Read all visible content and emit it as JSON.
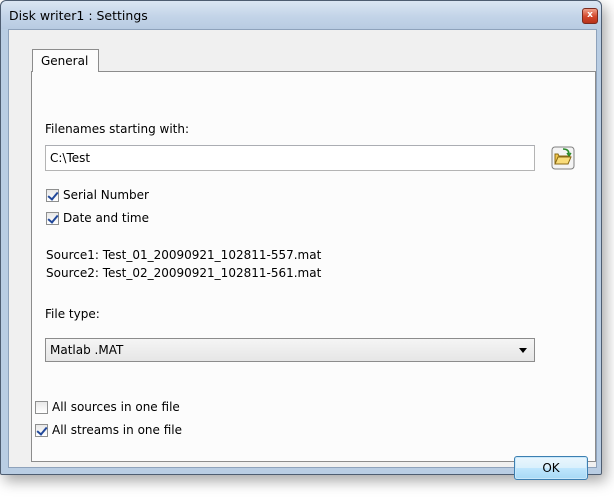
{
  "window": {
    "title": "Disk writer1 : Settings",
    "close_glyph": "x"
  },
  "tabs": [
    {
      "label": "General"
    }
  ],
  "general": {
    "filenames_label": "Filenames starting with:",
    "path_value": "C:\\Test",
    "serial_number": {
      "label": "Serial Number",
      "checked": true
    },
    "date_and_time": {
      "label": "Date and time",
      "checked": true
    },
    "preview": [
      "Source1: Test_01_20090921_102811-557.mat",
      "Source2: Test_02_20090921_102811-561.mat"
    ],
    "file_type_label": "File type:",
    "file_type_value": "Matlab .MAT",
    "all_sources": {
      "label": "All sources in one file",
      "checked": false
    },
    "all_streams": {
      "label": "All streams in one file",
      "checked": true
    }
  },
  "footer": {
    "ok_label": "OK"
  },
  "icons": {
    "folder": "open-folder-icon",
    "dropdown": "chevron-down-icon",
    "close": "close-icon"
  }
}
